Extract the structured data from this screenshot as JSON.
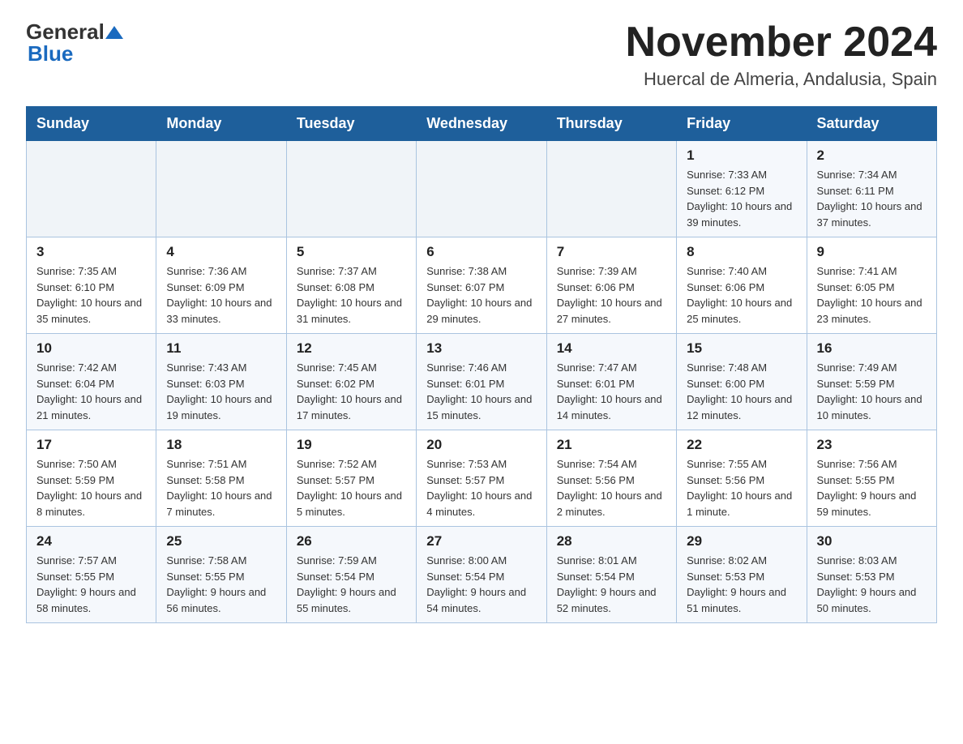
{
  "header": {
    "logo_general": "General",
    "logo_blue": "Blue",
    "month_title": "November 2024",
    "location": "Huercal de Almeria, Andalusia, Spain"
  },
  "weekdays": [
    "Sunday",
    "Monday",
    "Tuesday",
    "Wednesday",
    "Thursday",
    "Friday",
    "Saturday"
  ],
  "weeks": [
    [
      {
        "day": "",
        "info": ""
      },
      {
        "day": "",
        "info": ""
      },
      {
        "day": "",
        "info": ""
      },
      {
        "day": "",
        "info": ""
      },
      {
        "day": "",
        "info": ""
      },
      {
        "day": "1",
        "info": "Sunrise: 7:33 AM\nSunset: 6:12 PM\nDaylight: 10 hours and 39 minutes."
      },
      {
        "day": "2",
        "info": "Sunrise: 7:34 AM\nSunset: 6:11 PM\nDaylight: 10 hours and 37 minutes."
      }
    ],
    [
      {
        "day": "3",
        "info": "Sunrise: 7:35 AM\nSunset: 6:10 PM\nDaylight: 10 hours and 35 minutes."
      },
      {
        "day": "4",
        "info": "Sunrise: 7:36 AM\nSunset: 6:09 PM\nDaylight: 10 hours and 33 minutes."
      },
      {
        "day": "5",
        "info": "Sunrise: 7:37 AM\nSunset: 6:08 PM\nDaylight: 10 hours and 31 minutes."
      },
      {
        "day": "6",
        "info": "Sunrise: 7:38 AM\nSunset: 6:07 PM\nDaylight: 10 hours and 29 minutes."
      },
      {
        "day": "7",
        "info": "Sunrise: 7:39 AM\nSunset: 6:06 PM\nDaylight: 10 hours and 27 minutes."
      },
      {
        "day": "8",
        "info": "Sunrise: 7:40 AM\nSunset: 6:06 PM\nDaylight: 10 hours and 25 minutes."
      },
      {
        "day": "9",
        "info": "Sunrise: 7:41 AM\nSunset: 6:05 PM\nDaylight: 10 hours and 23 minutes."
      }
    ],
    [
      {
        "day": "10",
        "info": "Sunrise: 7:42 AM\nSunset: 6:04 PM\nDaylight: 10 hours and 21 minutes."
      },
      {
        "day": "11",
        "info": "Sunrise: 7:43 AM\nSunset: 6:03 PM\nDaylight: 10 hours and 19 minutes."
      },
      {
        "day": "12",
        "info": "Sunrise: 7:45 AM\nSunset: 6:02 PM\nDaylight: 10 hours and 17 minutes."
      },
      {
        "day": "13",
        "info": "Sunrise: 7:46 AM\nSunset: 6:01 PM\nDaylight: 10 hours and 15 minutes."
      },
      {
        "day": "14",
        "info": "Sunrise: 7:47 AM\nSunset: 6:01 PM\nDaylight: 10 hours and 14 minutes."
      },
      {
        "day": "15",
        "info": "Sunrise: 7:48 AM\nSunset: 6:00 PM\nDaylight: 10 hours and 12 minutes."
      },
      {
        "day": "16",
        "info": "Sunrise: 7:49 AM\nSunset: 5:59 PM\nDaylight: 10 hours and 10 minutes."
      }
    ],
    [
      {
        "day": "17",
        "info": "Sunrise: 7:50 AM\nSunset: 5:59 PM\nDaylight: 10 hours and 8 minutes."
      },
      {
        "day": "18",
        "info": "Sunrise: 7:51 AM\nSunset: 5:58 PM\nDaylight: 10 hours and 7 minutes."
      },
      {
        "day": "19",
        "info": "Sunrise: 7:52 AM\nSunset: 5:57 PM\nDaylight: 10 hours and 5 minutes."
      },
      {
        "day": "20",
        "info": "Sunrise: 7:53 AM\nSunset: 5:57 PM\nDaylight: 10 hours and 4 minutes."
      },
      {
        "day": "21",
        "info": "Sunrise: 7:54 AM\nSunset: 5:56 PM\nDaylight: 10 hours and 2 minutes."
      },
      {
        "day": "22",
        "info": "Sunrise: 7:55 AM\nSunset: 5:56 PM\nDaylight: 10 hours and 1 minute."
      },
      {
        "day": "23",
        "info": "Sunrise: 7:56 AM\nSunset: 5:55 PM\nDaylight: 9 hours and 59 minutes."
      }
    ],
    [
      {
        "day": "24",
        "info": "Sunrise: 7:57 AM\nSunset: 5:55 PM\nDaylight: 9 hours and 58 minutes."
      },
      {
        "day": "25",
        "info": "Sunrise: 7:58 AM\nSunset: 5:55 PM\nDaylight: 9 hours and 56 minutes."
      },
      {
        "day": "26",
        "info": "Sunrise: 7:59 AM\nSunset: 5:54 PM\nDaylight: 9 hours and 55 minutes."
      },
      {
        "day": "27",
        "info": "Sunrise: 8:00 AM\nSunset: 5:54 PM\nDaylight: 9 hours and 54 minutes."
      },
      {
        "day": "28",
        "info": "Sunrise: 8:01 AM\nSunset: 5:54 PM\nDaylight: 9 hours and 52 minutes."
      },
      {
        "day": "29",
        "info": "Sunrise: 8:02 AM\nSunset: 5:53 PM\nDaylight: 9 hours and 51 minutes."
      },
      {
        "day": "30",
        "info": "Sunrise: 8:03 AM\nSunset: 5:53 PM\nDaylight: 9 hours and 50 minutes."
      }
    ]
  ]
}
